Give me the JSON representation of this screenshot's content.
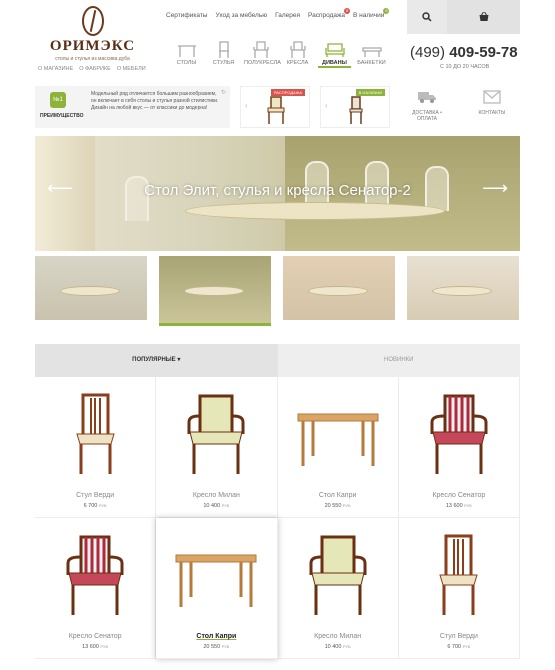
{
  "logo": {
    "brand": "ОРИМЭКС",
    "tagline": "столы и стулья из массива дуба"
  },
  "logo_links": [
    "О МАГАЗИНЕ",
    "О ФАБРИКЕ",
    "О МЕБЕЛИ"
  ],
  "topnav": [
    {
      "label": "Сертификаты"
    },
    {
      "label": "Уход за мебелью"
    },
    {
      "label": "Галерея"
    },
    {
      "label": "Распродажа",
      "badge": "8",
      "badge_color": "#d9534f"
    },
    {
      "label": "В наличии",
      "badge": "8",
      "badge_color": "#8db33a"
    }
  ],
  "categories": [
    {
      "label": "СТОЛЫ",
      "icon": "table-icon"
    },
    {
      "label": "СТУЛЬЯ",
      "icon": "chair-icon"
    },
    {
      "label": "ПОЛУКРЕСЛА",
      "icon": "armchair-icon"
    },
    {
      "label": "КРЕСЛА",
      "icon": "armchair-icon"
    },
    {
      "label": "ДИВАНЫ",
      "icon": "sofa-icon",
      "active": true
    },
    {
      "label": "БАНКЕТКИ",
      "icon": "bench-icon"
    }
  ],
  "phone": {
    "prefix": "(499)",
    "number": "409-59-78",
    "hours": "С 10 ДО 20 ЧАСОВ"
  },
  "promo": {
    "badge": "№1",
    "label": "ПРЕИМУЩЕСТВО",
    "text": "Модельный ряд отличается большим разнообразием, он включает в себя столы и стулья разной стилистики. Дизайн на любой вкус — от классики до модерна!"
  },
  "deals": [
    {
      "tag": "РАСПРОДАЖА",
      "tag_color": "#d9534f"
    },
    {
      "tag": "В НАЛИЧИИ",
      "tag_color": "#8db33a"
    }
  ],
  "side_links": [
    {
      "label": "ДОСТАВКА • ОПЛАТА",
      "icon": "truck-icon"
    },
    {
      "label": "КОНТАКТЫ",
      "icon": "mail-icon"
    }
  ],
  "hero": {
    "title": "Стол Элит, стулья и кресла Сенатор-2"
  },
  "product_tabs": [
    {
      "label": "ПОПУЛЯРНЫЕ ▾",
      "active": true
    },
    {
      "label": "НОВИНКИ"
    }
  ],
  "products": [
    {
      "name": "Стул Верди",
      "price": "6 700",
      "currency": "РУБ",
      "kind": "chair"
    },
    {
      "name": "Кресло Милан",
      "price": "10 400",
      "currency": "РУБ",
      "kind": "armchair"
    },
    {
      "name": "Стол Капри",
      "price": "20 550",
      "currency": "РУБ",
      "kind": "table"
    },
    {
      "name": "Кресло Сенатор",
      "price": "13 600",
      "currency": "РУБ",
      "kind": "stripe-armchair"
    },
    {
      "name": "Кресло Сенатор",
      "price": "13 600",
      "currency": "РУБ",
      "kind": "stripe-armchair"
    },
    {
      "name": "Стол Капри",
      "price": "20 550",
      "currency": "РУБ",
      "kind": "table",
      "highlight": true
    },
    {
      "name": "Кресло Милан",
      "price": "10 400",
      "currency": "РУБ",
      "kind": "armchair"
    },
    {
      "name": "Стул Верди",
      "price": "6 700",
      "currency": "РУБ",
      "kind": "chair"
    }
  ]
}
